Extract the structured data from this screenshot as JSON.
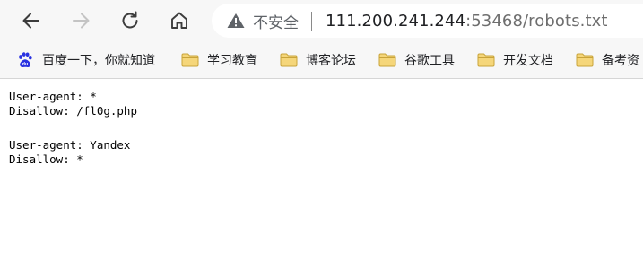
{
  "toolbar": {
    "back_icon": "arrow-left-icon",
    "forward_icon": "arrow-right-icon",
    "reload_icon": "reload-icon",
    "home_icon": "home-icon"
  },
  "address_bar": {
    "security_icon": "warning-triangle-icon",
    "security_label": "不安全",
    "url_host": "111.200.241.244",
    "url_rest": ":53468/robots.txt"
  },
  "bookmarks": [
    {
      "label": "百度一下，你就知道",
      "icon": "baidu-paw-icon"
    },
    {
      "label": "学习教育",
      "icon": "folder-icon"
    },
    {
      "label": "博客论坛",
      "icon": "folder-icon"
    },
    {
      "label": "谷歌工具",
      "icon": "folder-icon"
    },
    {
      "label": "开发文档",
      "icon": "folder-icon"
    },
    {
      "label": "备考资",
      "icon": "folder-icon"
    }
  ],
  "colors": {
    "chrome_bg": "#f7f7f7",
    "folder_fill": "#f5d67a",
    "folder_stroke": "#c9a43a",
    "baidu_blue": "#2932e1",
    "icon_gray": "#5f6368"
  },
  "document": {
    "block1": [
      "User-agent: *",
      "Disallow: /fl0g.php"
    ],
    "block2": [
      "User-agent: Yandex",
      "Disallow: *"
    ]
  }
}
